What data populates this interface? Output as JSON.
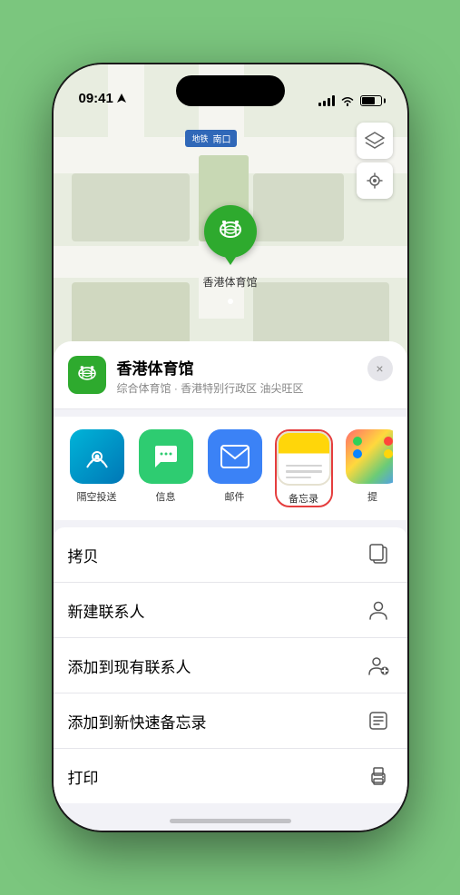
{
  "status_bar": {
    "time": "09:41",
    "location_arrow": "▶"
  },
  "map": {
    "subway_label": "南口",
    "pin_label": "香港体育馆"
  },
  "location_card": {
    "name": "香港体育馆",
    "description": "综合体育馆 · 香港特别行政区 油尖旺区",
    "close_label": "×"
  },
  "share_items": [
    {
      "id": "airdrop",
      "label": "隔空投送",
      "type": "airdrop"
    },
    {
      "id": "messages",
      "label": "信息",
      "type": "messages"
    },
    {
      "id": "mail",
      "label": "邮件",
      "type": "mail"
    },
    {
      "id": "notes",
      "label": "备忘录",
      "type": "notes"
    },
    {
      "id": "more",
      "label": "提",
      "type": "more"
    }
  ],
  "action_rows": [
    {
      "label": "拷贝",
      "icon": "copy"
    },
    {
      "label": "新建联系人",
      "icon": "person"
    },
    {
      "label": "添加到现有联系人",
      "icon": "person-add"
    },
    {
      "label": "添加到新快速备忘录",
      "icon": "note"
    },
    {
      "label": "打印",
      "icon": "print"
    }
  ]
}
